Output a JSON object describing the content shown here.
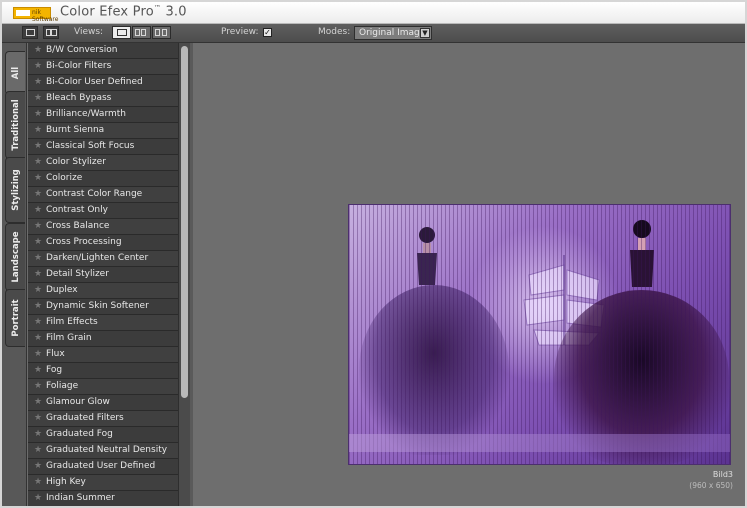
{
  "titlebar": {
    "logo_text": "nik Software",
    "app_title": "Color Efex Pro",
    "app_title_mark": "™",
    "app_version": "3.0"
  },
  "toolbar": {
    "views_label": "Views:",
    "preview_label": "Preview:",
    "preview_checked": true,
    "modes_label": "Modes:",
    "modes_value": "Original Image"
  },
  "tabs": [
    {
      "label": "All",
      "active": true
    },
    {
      "label": "Traditional",
      "active": false
    },
    {
      "label": "Stylizing",
      "active": false
    },
    {
      "label": "Landscape",
      "active": false
    },
    {
      "label": "Portrait",
      "active": false
    }
  ],
  "filters": [
    "B/W Conversion",
    "Bi-Color Filters",
    "Bi-Color User Defined",
    "Bleach Bypass",
    "Brilliance/Warmth",
    "Burnt Sienna",
    "Classical Soft Focus",
    "Color Stylizer",
    "Colorize",
    "Contrast Color Range",
    "Contrast Only",
    "Cross Balance",
    "Cross Processing",
    "Darken/Lighten Center",
    "Detail Stylizer",
    "Duplex",
    "Dynamic Skin Softener",
    "Film Effects",
    "Film Grain",
    "Flux",
    "Fog",
    "Foliage",
    "Glamour Glow",
    "Graduated Filters",
    "Graduated Fog",
    "Graduated Neutral Density",
    "Graduated User Defined",
    "High Key",
    "Indian Summer"
  ],
  "image": {
    "name": "Bild3",
    "dimensions": "(960 x 650)"
  },
  "colors": {
    "accent_logo": "#f4b400",
    "panel_bg": "#3c3c3c",
    "canvas_bg": "#6e6e6e"
  }
}
